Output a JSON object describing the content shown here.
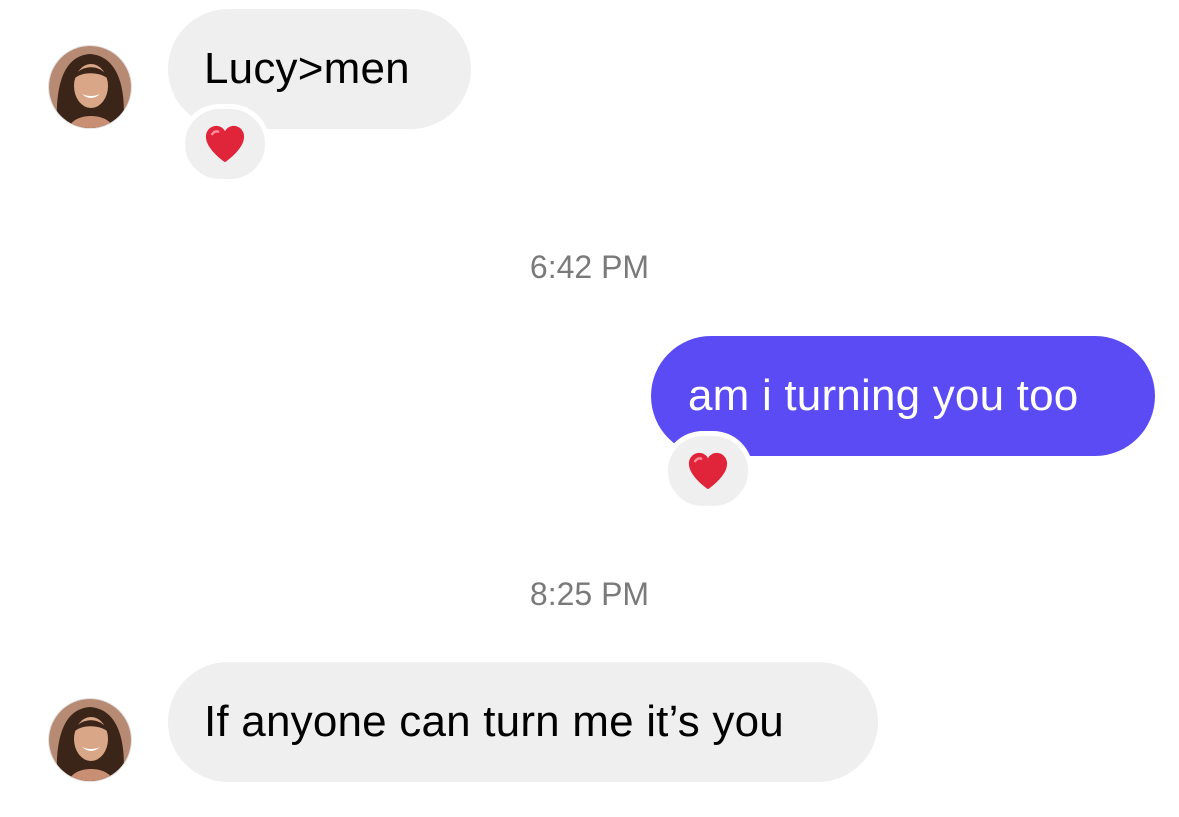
{
  "messages": [
    {
      "sender": "contact",
      "text": "Lucy>men",
      "reaction": "heart-icon"
    },
    {
      "timestamp": "6:42 PM"
    },
    {
      "sender": "me",
      "text": "am i turning you too",
      "reaction": "heart-icon"
    },
    {
      "timestamp": "8:25 PM"
    },
    {
      "sender": "contact",
      "text": "If anyone can turn me it’s you"
    }
  ],
  "colors": {
    "incoming_bubble": "#efefef",
    "outgoing_bubble": "#5b4bf5",
    "reaction_heart": "#e0243a",
    "timestamp_text": "#7a7a7a"
  }
}
